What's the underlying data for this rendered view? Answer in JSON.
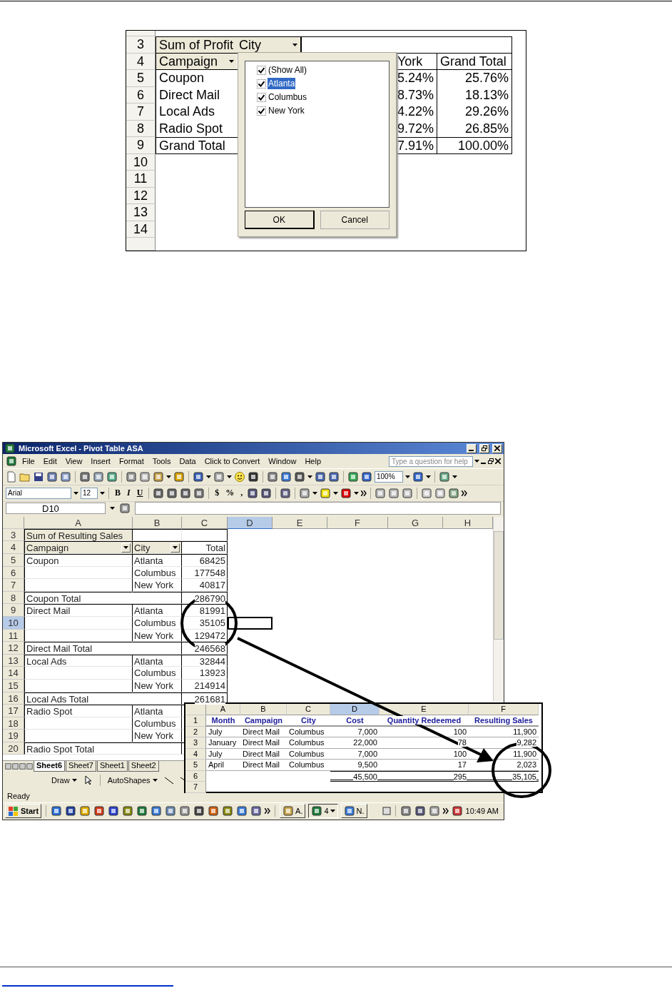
{
  "figure_1": {
    "row_numbers": [
      "3",
      "4",
      "5",
      "6",
      "7",
      "8",
      "9",
      "10",
      "11",
      "12",
      "13",
      "14"
    ],
    "pivot": {
      "data_field": "Sum of Profit",
      "column_field": "City",
      "row_field": "Campaign",
      "column_headers": [
        "York",
        "Grand Total"
      ],
      "rows": [
        {
          "label": "Coupon",
          "kind": "item",
          "values": [
            "5.24%",
            "25.76%"
          ]
        },
        {
          "label": "Direct Mail",
          "kind": "item",
          "values": [
            "8.73%",
            "18.13%"
          ]
        },
        {
          "label": "Local Ads",
          "kind": "item",
          "values": [
            "4.22%",
            "29.26%"
          ]
        },
        {
          "label": "Radio Spot",
          "kind": "item",
          "values": [
            "9.72%",
            "26.85%"
          ]
        },
        {
          "label": "Grand Total",
          "kind": "total",
          "values": [
            "7.91%",
            "100.00%"
          ]
        }
      ]
    },
    "filter_popup": {
      "items": [
        {
          "label": "(Show All)",
          "checked": true,
          "selected": false
        },
        {
          "label": "Atlanta",
          "checked": true,
          "selected": true
        },
        {
          "label": "Columbus",
          "checked": true,
          "selected": false
        },
        {
          "label": "New York",
          "checked": true,
          "selected": false
        }
      ],
      "buttons": [
        "OK",
        "Cancel"
      ]
    }
  },
  "excel_window": {
    "title": "Microsoft Excel - Pivot Table ASA",
    "menu": [
      "File",
      "Edit",
      "View",
      "Insert",
      "Format",
      "Tools",
      "Data",
      "Click to Convert",
      "Window",
      "Help"
    ],
    "help_box": {
      "placeholder": "Type a question for help"
    },
    "standard_toolbar": {
      "zoom": "100%"
    },
    "formatting_toolbar": {
      "font": "Arial",
      "size": "12",
      "buttons": [
        "B",
        "I",
        "U",
        "$",
        "%",
        ","
      ]
    },
    "name_box": "D10",
    "columns": [
      {
        "label": "A",
        "selected": false
      },
      {
        "label": "B",
        "selected": false
      },
      {
        "label": "C",
        "selected": false
      },
      {
        "label": "D",
        "selected": true
      },
      {
        "label": "E",
        "selected": false
      },
      {
        "label": "F",
        "selected": false
      },
      {
        "label": "G",
        "selected": false
      },
      {
        "label": "H",
        "selected": false
      }
    ],
    "rows": [
      {
        "number": "3",
        "selected": false,
        "kind": "title",
        "cells": [
          "Sum of Resulting Sales",
          "",
          ""
        ]
      },
      {
        "number": "4",
        "selected": false,
        "kind": "header",
        "cells": [
          "Campaign",
          "City",
          "Total"
        ]
      },
      {
        "number": "5",
        "selected": false,
        "kind": "item",
        "cells": [
          "Coupon",
          "Atlanta",
          "68425"
        ]
      },
      {
        "number": "6",
        "selected": false,
        "kind": "item",
        "cells": [
          "",
          "Columbus",
          "177548"
        ]
      },
      {
        "number": "7",
        "selected": false,
        "kind": "item",
        "cells": [
          "",
          "New York",
          "40817"
        ]
      },
      {
        "number": "8",
        "selected": false,
        "kind": "subtotal",
        "cells": [
          "Coupon Total",
          "",
          "286790"
        ]
      },
      {
        "number": "9",
        "selected": false,
        "kind": "item",
        "cells": [
          "Direct Mail",
          "Atlanta",
          "81991"
        ]
      },
      {
        "number": "10",
        "selected": true,
        "kind": "item",
        "cells": [
          "",
          "Columbus",
          "35105"
        ]
      },
      {
        "number": "11",
        "selected": false,
        "kind": "item",
        "cells": [
          "",
          "New York",
          "129472"
        ]
      },
      {
        "number": "12",
        "selected": false,
        "kind": "subtotal",
        "cells": [
          "Direct Mail Total",
          "",
          "246568"
        ]
      },
      {
        "number": "13",
        "selected": false,
        "kind": "item",
        "cells": [
          "Local Ads",
          "Atlanta",
          "32844"
        ]
      },
      {
        "number": "14",
        "selected": false,
        "kind": "item",
        "cells": [
          "",
          "Columbus",
          "13923"
        ]
      },
      {
        "number": "15",
        "selected": false,
        "kind": "item",
        "cells": [
          "",
          "New York",
          "214914"
        ]
      },
      {
        "number": "16",
        "selected": false,
        "kind": "subtotal",
        "cells": [
          "Local Ads Total",
          "",
          "261681"
        ]
      },
      {
        "number": "17",
        "selected": false,
        "kind": "item",
        "cells": [
          "Radio Spot",
          "Atlanta",
          ""
        ]
      },
      {
        "number": "18",
        "selected": false,
        "kind": "item",
        "cells": [
          "",
          "Columbus",
          ""
        ]
      },
      {
        "number": "19",
        "selected": false,
        "kind": "item",
        "cells": [
          "",
          "New York",
          ""
        ]
      },
      {
        "number": "20",
        "selected": false,
        "kind": "subtotal",
        "cells": [
          "Radio Spot Total",
          "",
          ""
        ]
      }
    ],
    "sheet_tabs": [
      {
        "label": "Sheet6",
        "selected": true
      },
      {
        "label": "Sheet7",
        "selected": false
      },
      {
        "label": "Sheet1",
        "selected": false
      },
      {
        "label": "Sheet2",
        "selected": false
      }
    ],
    "drawing_toolbar": [
      "Draw",
      "AutoShapes"
    ],
    "status": "Ready",
    "taskbar": {
      "start": "Start",
      "tasks": [
        "A.",
        "4",
        "N."
      ],
      "clock": "10:49 AM"
    },
    "inset_table": {
      "columns": [
        {
          "label": "A",
          "selected": false
        },
        {
          "label": "B",
          "selected": false
        },
        {
          "label": "C",
          "selected": false
        },
        {
          "label": "D",
          "selected": true
        },
        {
          "label": "E",
          "selected": false
        },
        {
          "label": "F",
          "selected": false
        }
      ],
      "rows": [
        {
          "number": "1",
          "kind": "header",
          "cells": [
            "Month",
            "Campaign",
            "City",
            "Cost",
            "Quantity Redeemed",
            "Resulting Sales"
          ]
        },
        {
          "number": "2",
          "kind": "data",
          "cells": [
            "July",
            "Direct Mail",
            "Columbus",
            "7,000",
            "100",
            "11,900"
          ]
        },
        {
          "number": "3",
          "kind": "data",
          "cells": [
            "January",
            "Direct Mail",
            "Columbus",
            "22,000",
            "78",
            "9,282"
          ]
        },
        {
          "number": "4",
          "kind": "data",
          "cells": [
            "July",
            "Direct Mail",
            "Columbus",
            "7,000",
            "100",
            "11,900"
          ]
        },
        {
          "number": "5",
          "kind": "data",
          "cells": [
            "April",
            "Direct Mail",
            "Columbus",
            "9,500",
            "17",
            "2,023"
          ]
        },
        {
          "number": "6",
          "kind": "total",
          "cells": [
            "",
            "",
            "",
            "45,500",
            "295",
            "35,105"
          ]
        },
        {
          "number": "7",
          "kind": "empty",
          "cells": [
            "",
            "",
            "",
            "",
            "",
            ""
          ]
        }
      ]
    }
  }
}
